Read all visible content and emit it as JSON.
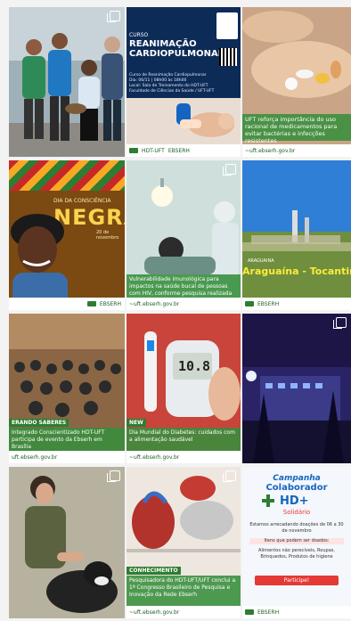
{
  "footer": {
    "site": "~uft.ebserh.gov.br",
    "site_short": "uft.ebserh.gov.br",
    "ebserh": "EBSERH",
    "hdt": "HDT-UFT"
  },
  "posts": [
    {
      "type": "photo-group"
    },
    {
      "course_label": "CURSO",
      "title": "REANIMAÇÃO CARDIOPULMONAR",
      "lines": [
        "Curso de Reanimação Cardiopulmonar",
        "Dia: 06/11 | 08h00 às 18h00",
        "Local: Sala de Treinamento do HDT-UFT",
        "Faculdade de Ciências da Saúde / UFT-UFT"
      ]
    },
    {
      "caption": "UFT reforça importância do uso racional de medicamentos para evitar bactérias e infecções resistentes"
    },
    {
      "kicker": "DIA DA CONSCIÊNCIA",
      "title": "NEGRA",
      "sub": "20 de novembro"
    },
    {
      "caption": "Vulnerabilidade imunológica para impactos na saúde bucal de pessoas com HIV, conforme pesquisa realizada no HDT-UFT"
    },
    {
      "subtitle": "ARAGUAINA",
      "title": "Araguaína - Tocantins"
    },
    {
      "badge": "ERANDO SABERES",
      "caption": "Integrado Conscientizado HDT-UFT participa de evento da Ebserh em Brasília"
    },
    {
      "glucose": "10.8",
      "badge": "NEW",
      "caption": "Dia Mundial do Diabetes: cuidados com a alimentação saudável"
    },
    {
      "type": "night-building"
    },
    {
      "type": "photo-dog"
    },
    {
      "badge": "CONHECIMENTO",
      "caption": "Pesquisadora do HDT-UFT/UFT conclui a 1ª Congresso Brasileiro de Pesquisa e Inovação da Rede Ebserh"
    },
    {
      "campaign_top": "Campanha",
      "campaign_title": "Colaborador",
      "campaign_brand": "HD+",
      "campaign_sub": "Solidário",
      "lines": [
        "Estamos arrecadando doações de 06 a 30 de novembro",
        "Itens que podem ser doados:",
        "Alimentos não perecíveis, Roupas, Brinquedos, Produtos de higiene"
      ],
      "cta": "Participe!"
    }
  ]
}
